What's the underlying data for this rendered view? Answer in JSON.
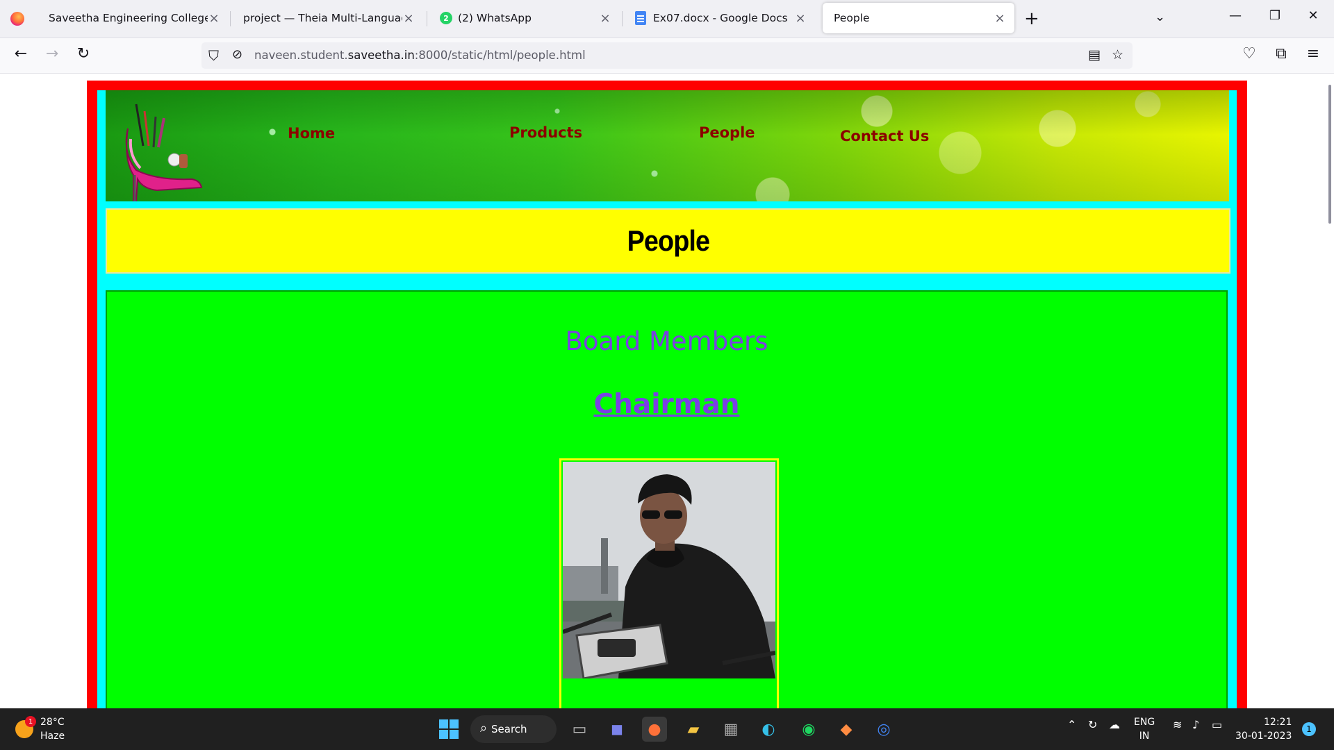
{
  "browser": {
    "tabs": [
      {
        "title": "Saveetha Engineering College",
        "active": false
      },
      {
        "title": "project — Theia Multi-Language Ex",
        "active": false
      },
      {
        "title": "(2) WhatsApp",
        "badge": "2",
        "active": false
      },
      {
        "title": "Ex07.docx - Google Docs",
        "active": false
      },
      {
        "title": "People",
        "active": true
      }
    ],
    "url": {
      "prefix": "naveen.student.",
      "host": "saveetha.in",
      "suffix": ":8000/static/html/people.html"
    }
  },
  "page": {
    "nav": {
      "home": "Home",
      "products": "Products",
      "people": "People",
      "contact": "Contact Us"
    },
    "title": "People",
    "section_heading": "Board Members",
    "role_heading": "Chairman",
    "colors": {
      "outer_frame": "#ff0000",
      "inner_frame": "#00ffff",
      "title_bg": "#ffff00",
      "content_bg": "#00ff00",
      "heading_color": "#7b3fe4",
      "nav_link_color": "#8b0000"
    }
  },
  "taskbar": {
    "weather": {
      "temp": "28°C",
      "condition": "Haze",
      "badge": "1"
    },
    "search_label": "Search",
    "language": {
      "line1": "ENG",
      "line2": "IN"
    },
    "time": "12:21",
    "date": "30-01-2023",
    "notification_count": "1"
  }
}
